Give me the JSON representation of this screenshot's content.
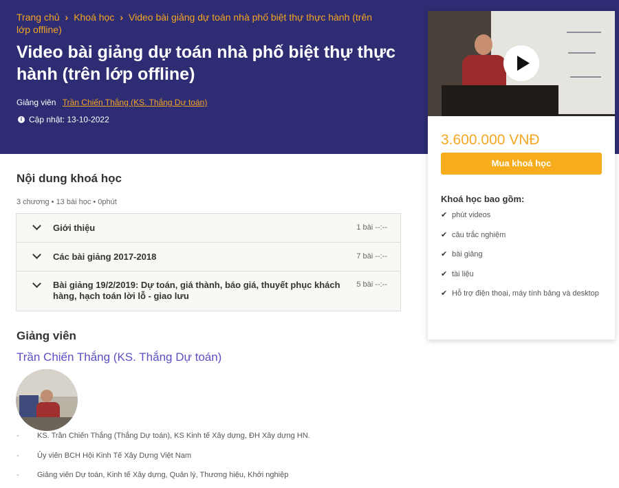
{
  "colors": {
    "hero_bg": "#2e2c72",
    "accent_orange": "#f5a623",
    "instructor_link": "#5a4fc4",
    "buy_button": "#f6ac1b"
  },
  "breadcrumb": {
    "items": [
      "Trang chủ",
      "Khoá học",
      "Video bài giảng dự toán nhà phố biệt thự thực hành (trên lớp offline)"
    ]
  },
  "hero": {
    "title": "Video bài giảng dự toán nhà phố biệt thự thực hành (trên lớp offline)",
    "instructor_label": "Giảng viên",
    "instructor_name": "Trần Chiến Thắng (KS. Thắng Dự toán)",
    "updated": "Cập nhật: 13-10-2022"
  },
  "sidebar_card": {
    "price": "3.600.000 VNĐ",
    "buy_label": "Mua khoá học",
    "includes_title": "Khoá học bao gồm:",
    "includes": [
      "phút videos",
      "câu trắc nghiệm",
      "bài giảng",
      "tài liệu",
      "Hỗ trợ điện thoại, máy tính bảng và desktop"
    ]
  },
  "course_content": {
    "title": "Nội dung khoá học",
    "meta": "3 chương • 13 bài học • 0phút",
    "sections": [
      {
        "label": "Giới thiệu",
        "count": "1 bài --:--"
      },
      {
        "label": "Các bài giảng 2017-2018",
        "count": "7 bài --:--"
      },
      {
        "label": "Bài giảng 19/2/2019: Dự toán, giá thành, báo giá, thuyết phục khách hàng, hạch toán lời lỗ - giao lưu",
        "count": "5 bài --:--"
      }
    ]
  },
  "instructor": {
    "heading": "Giảng viên",
    "name": "Trần Chiến Thắng (KS. Thắng Dự toán)",
    "bio": [
      "KS. Trần Chiến Thắng (Thắng Dự toán), KS Kinh tế Xây dựng, ĐH Xây dựng HN.",
      "Ủy viên BCH Hội Kinh Tế Xây Dựng Việt Nam",
      "Giảng viên Dự toán, Kinh tế Xây dựng, Quản lý, Thương hiệu, Khởi nghiệp"
    ],
    "bio_bullet": "-"
  }
}
